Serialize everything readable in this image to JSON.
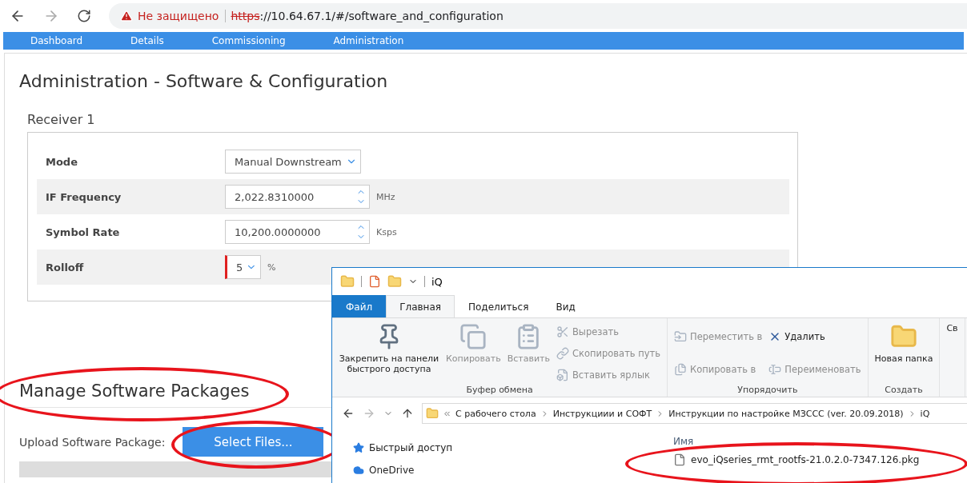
{
  "browser": {
    "security_label": "Не защищено",
    "scheme": "https",
    "url_rest": "://10.64.67.1/#/software_and_configuration"
  },
  "nav": [
    "Dashboard",
    "Details",
    "Commissioning",
    "Administration"
  ],
  "page_title": "Administration - Software & Configuration",
  "receiver": {
    "title": "Receiver 1",
    "rows": [
      {
        "kind": "select",
        "label": "Mode",
        "value": "Manual Downstream",
        "invalid": false
      },
      {
        "kind": "spin",
        "label": "IF Frequency",
        "value": "2,022.8310000",
        "unit": "MHz",
        "invalid": false
      },
      {
        "kind": "spin",
        "label": "Symbol Rate",
        "value": "10,200.0000000",
        "unit": "Ksps",
        "invalid": false
      },
      {
        "kind": "select",
        "label": "Rolloff",
        "value": "5",
        "unit": "%",
        "invalid": true
      }
    ]
  },
  "packages": {
    "title": "Manage Software Packages",
    "upload_label": "Upload Software Package:",
    "button": "Select Files..."
  },
  "explorer": {
    "title": "iQ",
    "tabs": [
      {
        "label": "Файл",
        "kind": "file",
        "selected": false
      },
      {
        "label": "Главная",
        "kind": "tab",
        "selected": true
      },
      {
        "label": "Поделиться",
        "kind": "tab",
        "selected": false
      },
      {
        "label": "Вид",
        "kind": "tab",
        "selected": false
      }
    ],
    "groups": [
      {
        "label": "Буфер обмена",
        "items": [
          {
            "kind": "large",
            "label": "Закрепить на панели быстрого доступа",
            "disabled": false
          },
          {
            "kind": "large",
            "label": "Копировать",
            "disabled": true
          },
          {
            "kind": "large",
            "label": "Вставить",
            "disabled": true
          },
          {
            "kind": "small",
            "label": "Вырезать",
            "disabled": true
          },
          {
            "kind": "small",
            "label": "Скопировать путь",
            "disabled": true
          },
          {
            "kind": "small",
            "label": "Вставить ярлык",
            "disabled": true
          }
        ]
      },
      {
        "label": "Упорядочить",
        "items": [
          {
            "kind": "small",
            "label": "Переместить в",
            "disabled": true
          },
          {
            "kind": "small",
            "label": "Копировать в",
            "disabled": true
          },
          {
            "kind": "small",
            "label": "Удалить",
            "disabled": false
          },
          {
            "kind": "small",
            "label": "Переименовать",
            "disabled": true
          }
        ]
      },
      {
        "label": "Создать",
        "items": [
          {
            "kind": "large",
            "label": "Новая папка",
            "disabled": false
          }
        ]
      },
      {
        "items": [
          {
            "kind": "large",
            "label": "Св",
            "disabled": false
          }
        ]
      }
    ],
    "breadcrumbs": [
      "С рабочего стола",
      "Инструкциии и СОФТ",
      "Инструкции по настройке МЗССС (ver. 20.09.2018)",
      "iQ"
    ],
    "nav_items": [
      "Быстрый доступ",
      "OneDrive"
    ],
    "column": "Имя",
    "files": [
      "evo_iQseries_rmt_rootfs-21.0.2.0-7347.126.pkg"
    ]
  }
}
